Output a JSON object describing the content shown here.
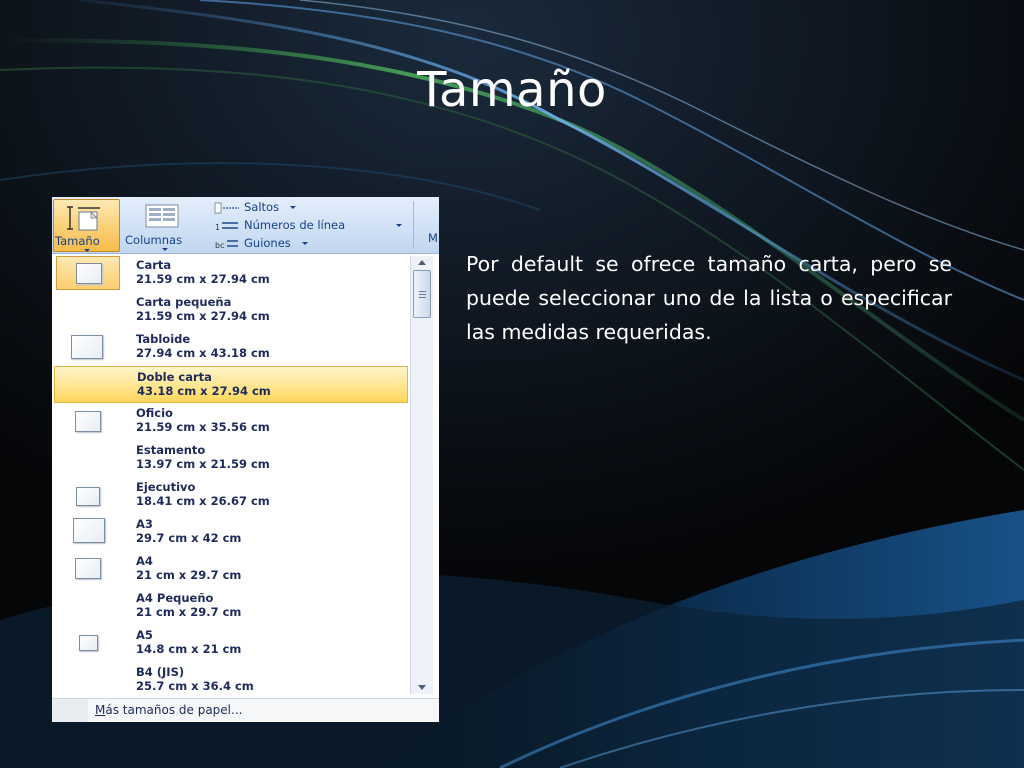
{
  "slide": {
    "title": "Tamaño",
    "body": "Por default se ofrece tamaño carta, pero se puede seleccionar uno de la lista o especificar las medidas requeridas."
  },
  "ribbon": {
    "tamano_label": "Tamaño",
    "columnas_label": "Columnas",
    "saltos_label": "Saltos",
    "numeros_label": "Números de línea",
    "guiones_label": "Guiones",
    "partial_label": "M"
  },
  "sizes": [
    {
      "name": "Carta",
      "dims": "21.59 cm x 27.94 cm"
    },
    {
      "name": "Carta pequeña",
      "dims": "21.59 cm x 27.94 cm"
    },
    {
      "name": "Tabloide",
      "dims": "27.94 cm x 43.18 cm"
    },
    {
      "name": "Doble carta",
      "dims": "43.18 cm x 27.94 cm"
    },
    {
      "name": "Oficio",
      "dims": "21.59 cm x 35.56 cm"
    },
    {
      "name": "Estamento",
      "dims": "13.97 cm x 21.59 cm"
    },
    {
      "name": "Ejecutivo",
      "dims": "18.41 cm x 26.67 cm"
    },
    {
      "name": "A3",
      "dims": "29.7 cm x 42 cm"
    },
    {
      "name": "A4",
      "dims": "21 cm x 29.7 cm"
    },
    {
      "name": "A4 Pequeño",
      "dims": "21 cm x 29.7 cm"
    },
    {
      "name": "A5",
      "dims": "14.8 cm x 21 cm"
    },
    {
      "name": "B4 (JIS)",
      "dims": "25.7 cm x 36.4 cm"
    }
  ],
  "selected_size": "Carta",
  "hovered_size": "Doble carta",
  "footer": {
    "more_sizes_first": "M",
    "more_sizes_rest": "ás tamaños de papel..."
  },
  "colors": {
    "ribbon_text": "#15428b",
    "highlight": "#ffe48a",
    "item_text": "#1e2b5a"
  }
}
